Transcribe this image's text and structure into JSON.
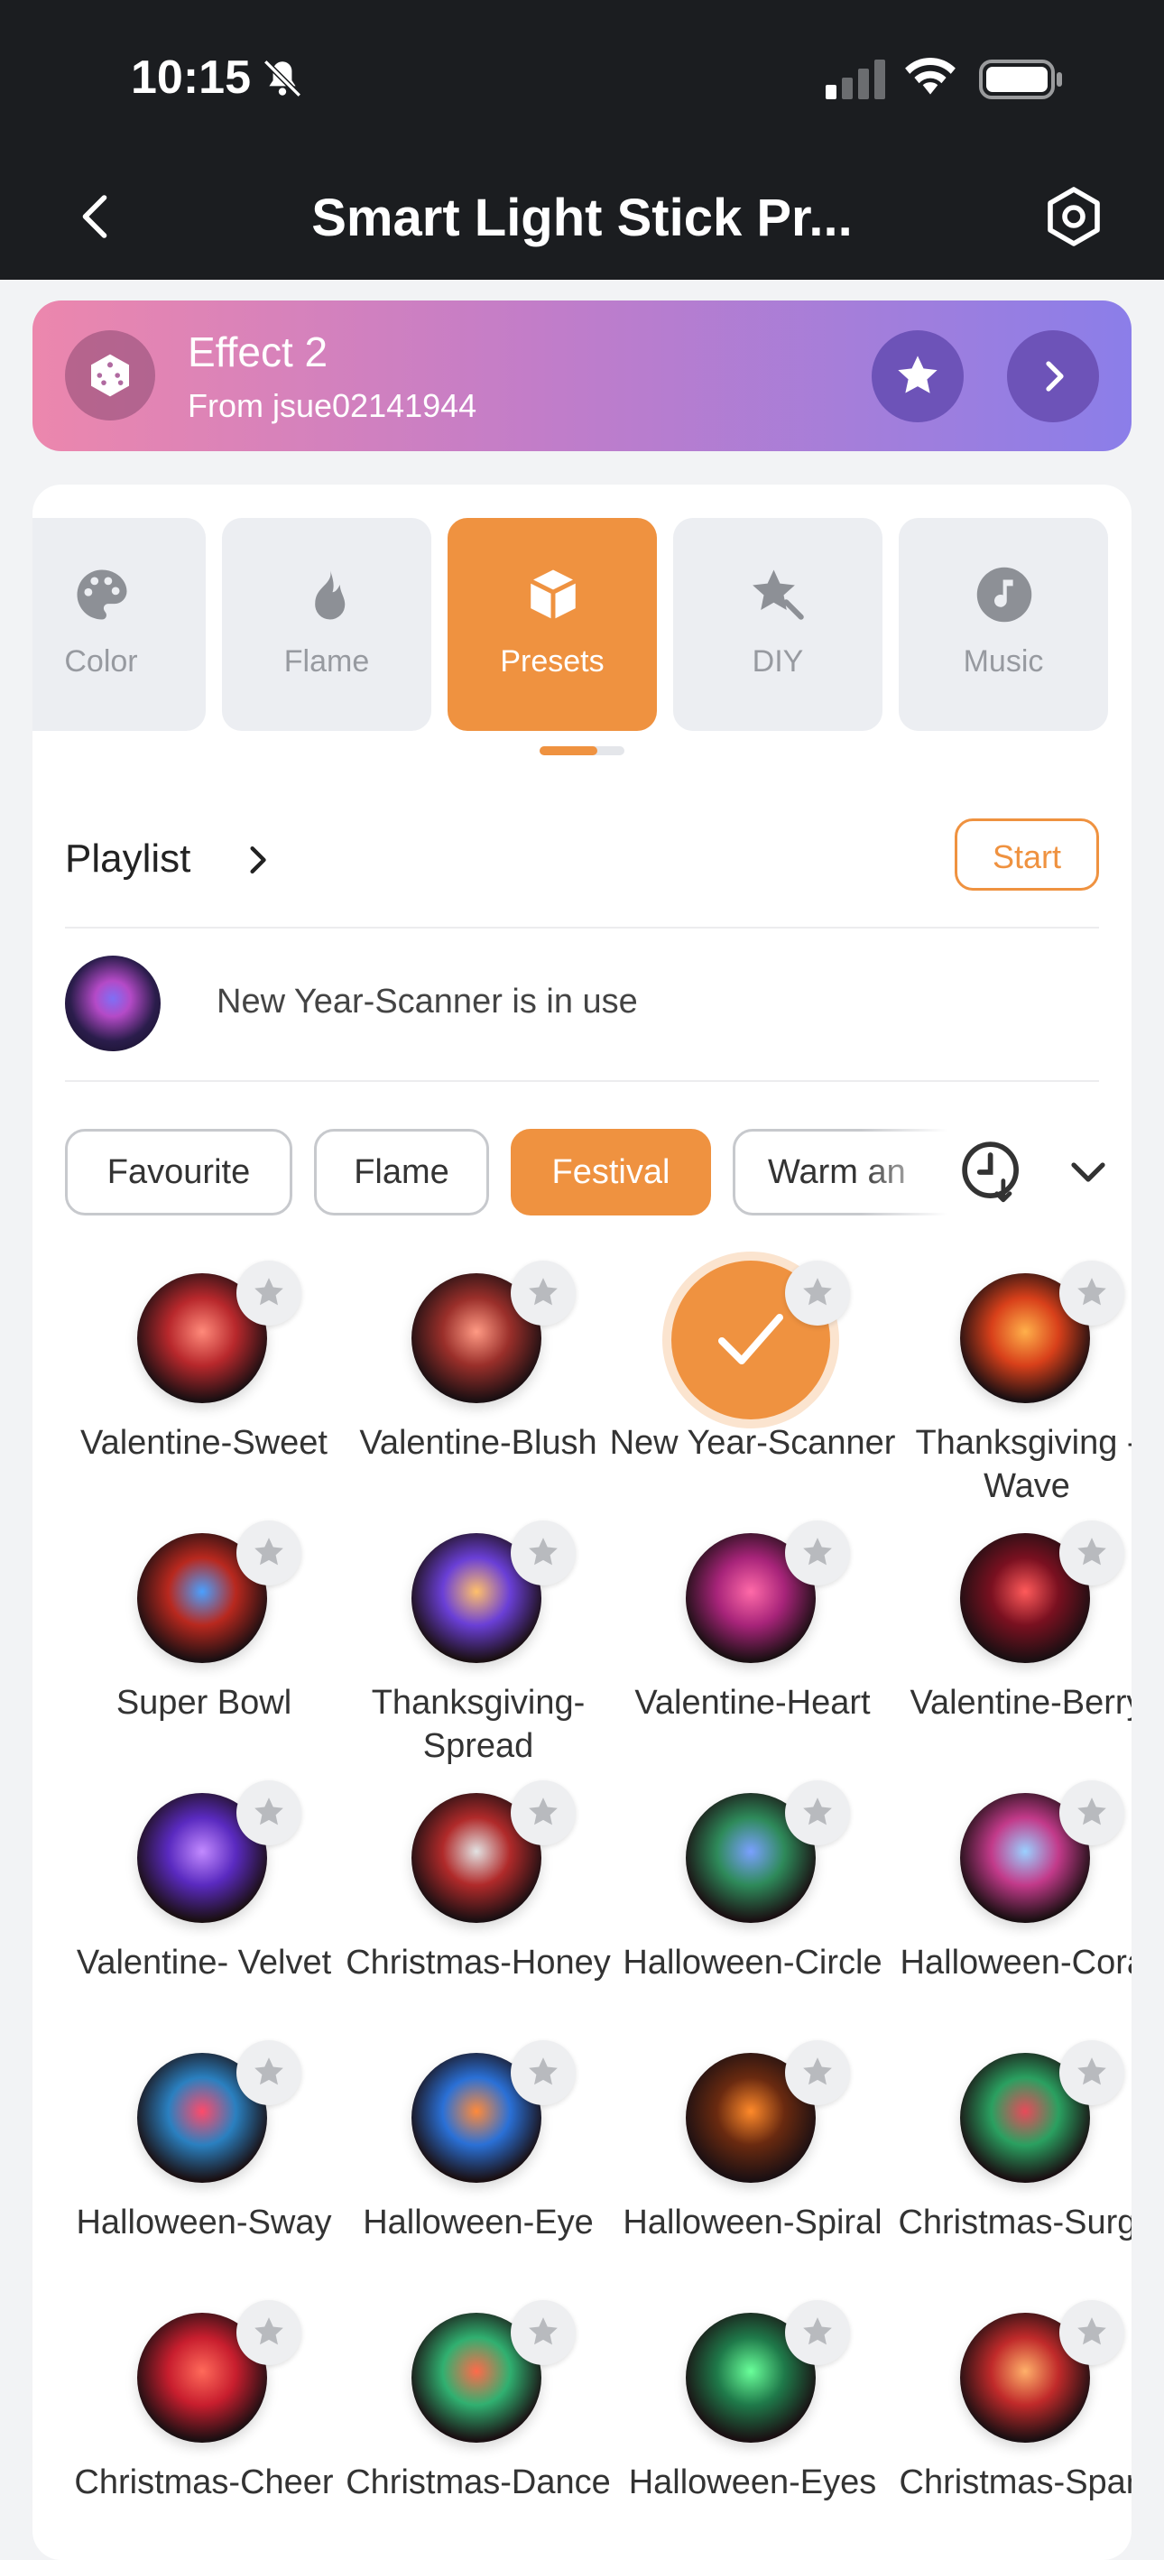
{
  "status_bar": {
    "time": "10:15"
  },
  "nav": {
    "title": "Smart Light Stick Pr..."
  },
  "effect": {
    "name": "Effect 2",
    "from": "From jsue02141944"
  },
  "tabs": [
    {
      "label": "Color",
      "active": false
    },
    {
      "label": "Flame",
      "active": false
    },
    {
      "label": "Presets",
      "active": true
    },
    {
      "label": "DIY",
      "active": false
    },
    {
      "label": "Music",
      "active": false
    }
  ],
  "playlist": {
    "title": "Playlist",
    "start_label": "Start"
  },
  "in_use": {
    "text": "New Year-Scanner is in use"
  },
  "chips": [
    {
      "label": "Favourite",
      "active": false
    },
    {
      "label": "Flame",
      "active": false
    },
    {
      "label": "Festival",
      "active": true
    },
    {
      "label": "Warm an",
      "active": false
    }
  ],
  "presets": [
    {
      "label": "Valentine-Sweet",
      "colors": [
        "#ff8a7a",
        "#b8282c"
      ]
    },
    {
      "label": "Valentine-Blush",
      "colors": [
        "#ff9a84",
        "#9a2f2a"
      ]
    },
    {
      "label": "New Year-Scanner",
      "selected": true
    },
    {
      "label": "Thanksgiving - Wave",
      "colors": [
        "#ffb04a",
        "#d8401a"
      ]
    },
    {
      "label": "Super Bowl",
      "colors": [
        "#4aa0ff",
        "#b8281e"
      ]
    },
    {
      "label": "Thanksgiving-Spread",
      "colors": [
        "#ffc06a",
        "#6a3fd6"
      ]
    },
    {
      "label": "Valentine-Heart",
      "colors": [
        "#ff6aa8",
        "#a8247a"
      ]
    },
    {
      "label": "Valentine-Berry",
      "colors": [
        "#ff5a5a",
        "#7a1020"
      ]
    },
    {
      "label": "Valentine- Velvet",
      "colors": [
        "#c28aff",
        "#5a2ac0"
      ]
    },
    {
      "label": "Christmas-Honey",
      "colors": [
        "#e2e2e2",
        "#b02a2a"
      ]
    },
    {
      "label": "Halloween-Circle",
      "colors": [
        "#7aa0ff",
        "#2e8a5a"
      ]
    },
    {
      "label": "Halloween-Coral",
      "colors": [
        "#9ad0ff",
        "#c23a8a"
      ]
    },
    {
      "label": "Halloween-Sway",
      "colors": [
        "#ff4a6a",
        "#2a80c0"
      ]
    },
    {
      "label": "Halloween-Eye",
      "colors": [
        "#ff8a3a",
        "#2a70d6"
      ]
    },
    {
      "label": "Halloween-Spiral",
      "colors": [
        "#ff8a2a",
        "#6a2a10"
      ]
    },
    {
      "label": "Christmas-Surge",
      "colors": [
        "#e84a5a",
        "#2aa060"
      ]
    },
    {
      "label": "Christmas-Cheer",
      "colors": [
        "#ff6a5a",
        "#c81e2e"
      ]
    },
    {
      "label": "Christmas-Dance",
      "colors": [
        "#ff6a4a",
        "#30b070"
      ]
    },
    {
      "label": "Halloween-Eyes",
      "colors": [
        "#6aff9a",
        "#1f7a4a"
      ]
    },
    {
      "label": "Christmas-Spark",
      "colors": [
        "#ffb06a",
        "#c02a2a"
      ]
    }
  ]
}
